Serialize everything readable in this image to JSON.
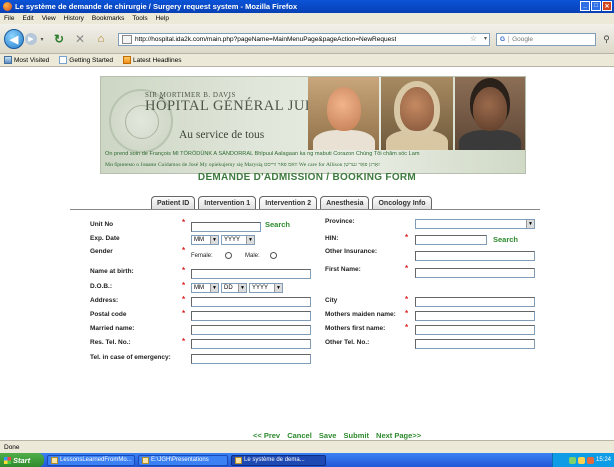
{
  "window": {
    "title": "Le système de demande de chirurgie / Surgery request system - Mozilla Firefox"
  },
  "menu": [
    "File",
    "Edit",
    "View",
    "History",
    "Bookmarks",
    "Tools",
    "Help"
  ],
  "nav": {
    "url": "http://hospital.ida2k.com/main.php?pageName=MainMenuPage&pageAction=NewRequest",
    "search_engine": "G",
    "search_placeholder": "Google"
  },
  "bookmarks": [
    "Most Visited",
    "Getting Started",
    "Latest Headlines"
  ],
  "banner": {
    "sir": "SIR MORTIMER B. DAVIS",
    "hospital": "HÔPITAL GÉNÉRAL JUIF",
    "service": "Au service de tous",
    "tagline1": "On prend soin de François  MI TÖRÖDÜNK A SÁNDORRAL  Bhlpuul  Aalagaan ka ng mabuti Corazon  Chúng Tôi chăm sóc Lam",
    "tagline2": "Ми бpинемо o Јовани  Cuidamos de José  My opiekujemy się Marysią  וואס פאר ווייסט  We care for Allison  זאָרגן פאַר גערשן"
  },
  "form_title": "DEMANDE D'ADMISSION / BOOKING FORM",
  "tabs": [
    "Patient ID",
    "Intervention 1",
    "Intervention 2",
    "Anesthesia",
    "Oncology Info"
  ],
  "form": {
    "unit_no": "Unit No",
    "search": "Search",
    "exp_date": "Exp. Date",
    "mm": "MM",
    "yyyy": "YYYY",
    "dd": "DD",
    "gender": "Gender",
    "female": "Female:",
    "male": "Male:",
    "name_at_birth": "Name at birth:",
    "dob": "D.O.B.:",
    "address": "Address:",
    "postal_code": "Postal code",
    "married_name": "Married name:",
    "res_tel": "Res. Tel. No.:",
    "tel_emergency": "Tel. in case of emergency:",
    "province": "Province:",
    "hin": "HIN:",
    "other_insurance": "Other Insurance:",
    "first_name": "First Name:",
    "city": "City",
    "mothers_maiden": "Mothers maiden name:",
    "mothers_first": "Mothers first name:",
    "other_tel": "Other Tel. No.:"
  },
  "bottom_nav": {
    "prev": "<< Prev",
    "cancel": "Cancel",
    "save": "Save",
    "submit": "Submit",
    "next": "Next Page>>"
  },
  "status": "Done",
  "taskbar": {
    "start": "Start",
    "items": [
      "LessonsLearnedFromMo...",
      "E:\\JGH\\Presentations",
      "Le système de dema..."
    ],
    "clock": "15:24"
  }
}
